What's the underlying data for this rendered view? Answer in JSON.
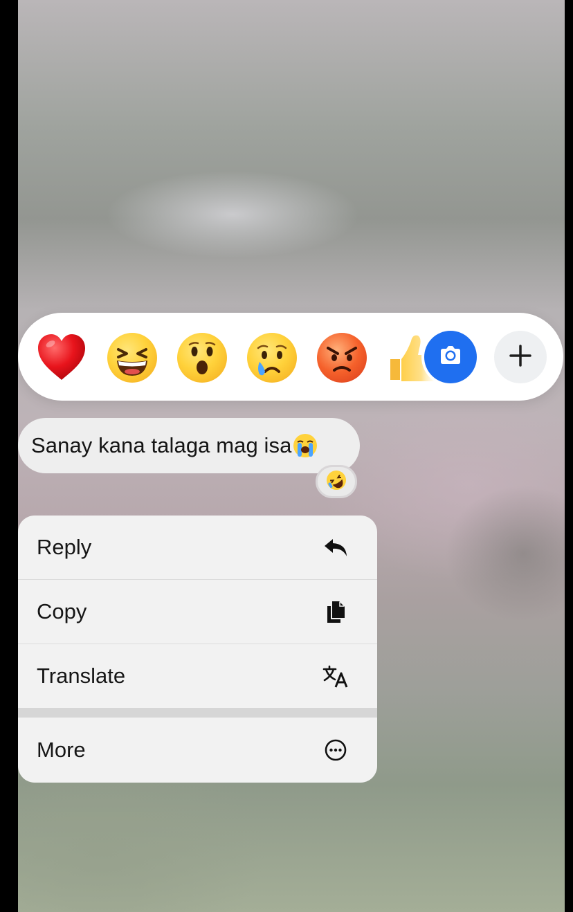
{
  "reactions": [
    {
      "name": "red-heart",
      "glyph": "heart"
    },
    {
      "name": "laughing-face",
      "glyph": "laughing"
    },
    {
      "name": "surprised-face",
      "glyph": "open-mouth"
    },
    {
      "name": "crying-face",
      "glyph": "crying"
    },
    {
      "name": "angry-face",
      "glyph": "pouting"
    },
    {
      "name": "thumbs-up",
      "glyph": "thumbs-up"
    }
  ],
  "reaction_bar": {
    "camera_icon": "camera-icon",
    "add_icon": "plus-icon",
    "accent_color": "#1f6ff0"
  },
  "message": {
    "text": "Sanay kana talaga mag isa",
    "trailing_emoji": "loudly-crying-face",
    "reaction": "rolling-on-floor-laughing"
  },
  "menu": {
    "items": [
      {
        "label": "Reply",
        "icon": "reply-arrow-icon"
      },
      {
        "label": "Copy",
        "icon": "copy-icon"
      },
      {
        "label": "Translate",
        "icon": "translate-icon"
      }
    ],
    "more": {
      "label": "More",
      "icon": "more-ellipsis-icon"
    }
  }
}
